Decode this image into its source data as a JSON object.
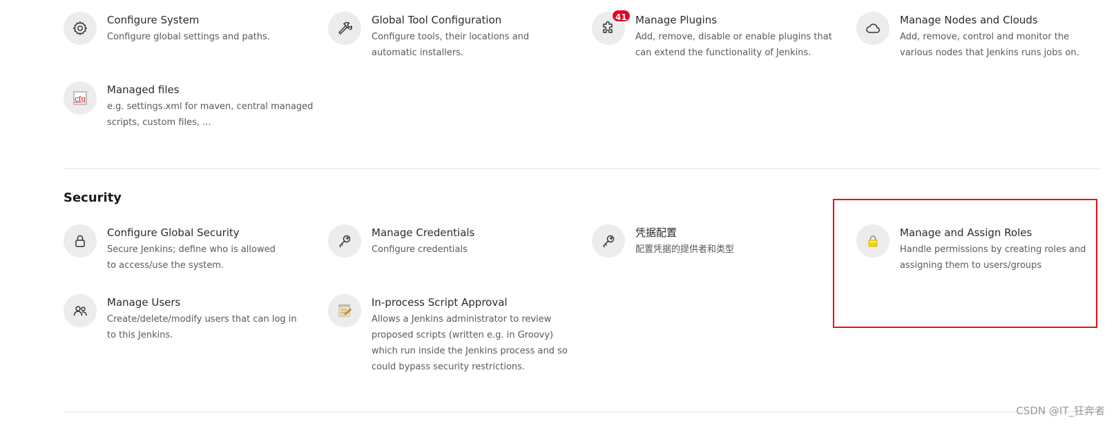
{
  "system_items": [
    {
      "title": "Configure System",
      "description": "Configure global settings and paths.",
      "icon": "gear-icon"
    },
    {
      "title": "Global Tool Configuration",
      "description": "Configure tools, their locations and automatic installers.",
      "icon": "hammer-icon"
    },
    {
      "title": "Manage Plugins",
      "description": "Add, remove, disable or enable plugins that can extend the functionality of Jenkins.",
      "icon": "puzzle-icon",
      "badge": "41"
    },
    {
      "title": "Manage Nodes and Clouds",
      "description": "Add, remove, control and monitor the various nodes that Jenkins runs jobs on.",
      "icon": "cloud-icon"
    },
    {
      "title": "Managed files",
      "description": "e.g. settings.xml for maven, central managed scripts, custom files, ...",
      "icon": "cfg-file-icon",
      "icon_text": "cfg"
    }
  ],
  "security": {
    "heading": "Security",
    "items": [
      {
        "title": "Configure Global Security",
        "description": "Secure Jenkins; define who is allowed to access/use the system.",
        "icon": "lock-icon"
      },
      {
        "title": "Manage Credentials",
        "description": "Configure credentials",
        "icon": "key-icon"
      },
      {
        "title": "凭据配置",
        "description": "配置凭据的提供者和类型",
        "icon": "key-icon"
      },
      {
        "title": "Manage and Assign Roles",
        "description": "Handle permissions by creating roles and assigning them to users/groups",
        "icon": "yellow-padlock-icon"
      },
      {
        "title": "Manage Users",
        "description": "Create/delete/modify users that can log in to this Jenkins.",
        "icon": "users-icon"
      },
      {
        "title": "In-process Script Approval",
        "description": "Allows a Jenkins administrator to review proposed scripts (written e.g. in Groovy) which run inside the Jenkins process and so could bypass security restrictions.",
        "icon": "notepad-icon"
      }
    ]
  },
  "colors": {
    "badge": "#e6001f",
    "highlight": "#f20d0d",
    "icon_bg": "#ececee",
    "padlock": "#f2d600"
  },
  "watermark": "CSDN @IT_狂奔者"
}
